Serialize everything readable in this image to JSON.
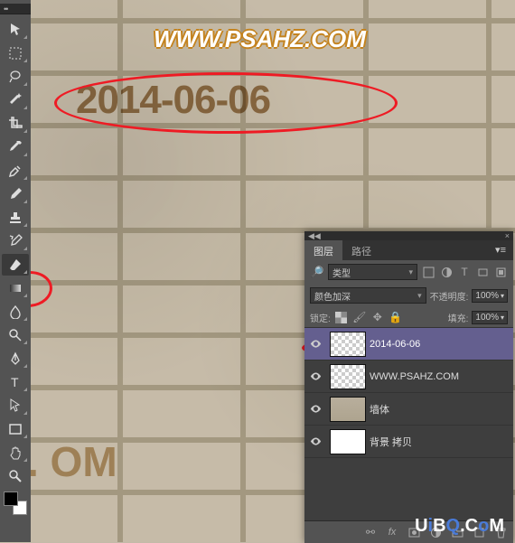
{
  "canvas": {
    "title": "WWW.PSAHZ.COM",
    "date": "2014-06-06",
    "faded": ". OM"
  },
  "panel": {
    "tabs": {
      "layers": "图层",
      "paths": "路径"
    },
    "kind_label": "类型",
    "blend_mode": "颜色加深",
    "opacity_label": "不透明度:",
    "opacity_value": "100%",
    "lock_label": "锁定:",
    "fill_label": "填充:",
    "fill_value": "100%",
    "layers": [
      {
        "name": "2014-06-06",
        "selected": true,
        "thumb": "trans"
      },
      {
        "name": "WWW.PSAHZ.COM",
        "selected": false,
        "thumb": "trans"
      },
      {
        "name": "墙体",
        "selected": false,
        "thumb": "wall"
      },
      {
        "name": "背景 拷贝",
        "selected": false,
        "thumb": "white"
      }
    ]
  },
  "tools": [
    "move",
    "marquee",
    "lasso",
    "wand",
    "crop",
    "eyedrop",
    "heal",
    "brush",
    "stamp",
    "history",
    "eraser",
    "gradient",
    "blur",
    "dodge",
    "pen",
    "type",
    "path",
    "rect",
    "hand",
    "zoom"
  ],
  "watermark": {
    "pre": "U",
    "mid": "i",
    "b": "B",
    "post": "Q.",
    "c": "C",
    "o": "o",
    "m": "M"
  }
}
